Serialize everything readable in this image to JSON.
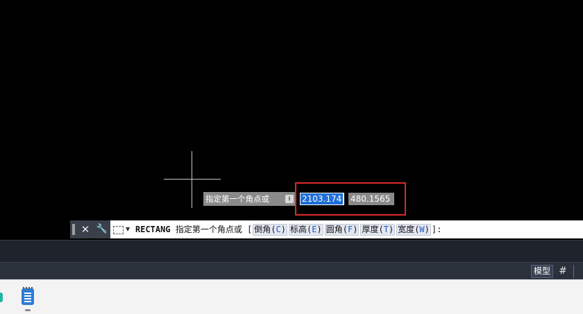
{
  "tooltip": {
    "prompt": "指定第一个角点或",
    "arrow_icon": "down-arrow-icon"
  },
  "dynamic_input": {
    "x_value": "2103.174",
    "y_value": "480.1565",
    "highlight_color": "#e0282c"
  },
  "command_line": {
    "close_icon": "close-icon",
    "settings_icon": "wrench-icon",
    "command": "RECTANG",
    "prompt": "指定第一个角点或",
    "open_bracket": "[",
    "close_bracket": "]:",
    "options": [
      {
        "label": "倒角",
        "key": "C"
      },
      {
        "label": "标高",
        "key": "E"
      },
      {
        "label": "圆角",
        "key": "F"
      },
      {
        "label": "厚度",
        "key": "T"
      },
      {
        "label": "宽度",
        "key": "W"
      }
    ]
  },
  "status_bar": {
    "model_tab": "模型",
    "grid_icon": "grid-icon"
  },
  "taskbar": {
    "apps": [
      "teal-app-icon",
      "notepad-icon"
    ]
  }
}
